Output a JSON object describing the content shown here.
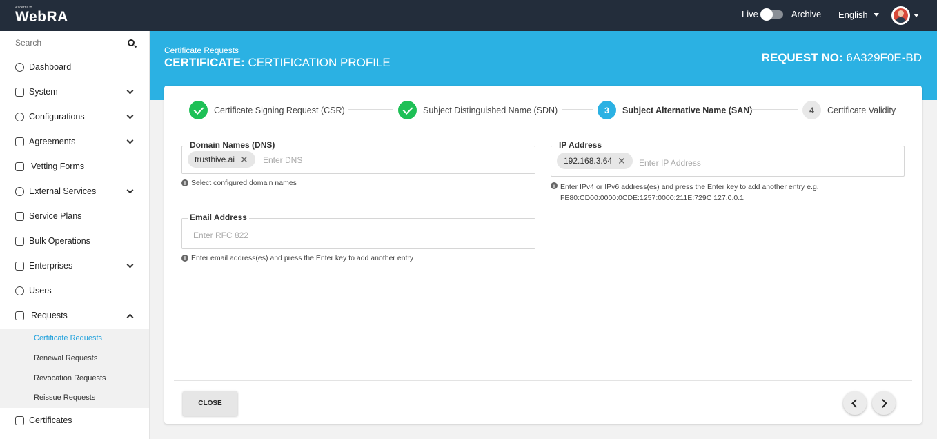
{
  "topbar": {
    "brand_small": "Ascertia™",
    "brand": "WebRA",
    "live_label": "Live",
    "archive_label": "Archive",
    "language": "English"
  },
  "sidebar": {
    "search_placeholder": "Search",
    "items": [
      {
        "label": "Dashboard",
        "icon": "dashboard-icon"
      },
      {
        "label": "System",
        "icon": "system-icon"
      },
      {
        "label": "Configurations",
        "icon": "gear-icon"
      },
      {
        "label": "Agreements",
        "icon": "handshake-icon"
      },
      {
        "label": "Vetting Forms",
        "icon": "form-icon"
      },
      {
        "label": "External Services",
        "icon": "link-icon"
      },
      {
        "label": "Service Plans",
        "icon": "plans-icon"
      },
      {
        "label": "Bulk Operations",
        "icon": "boxes-icon"
      },
      {
        "label": "Enterprises",
        "icon": "bank-icon"
      },
      {
        "label": "Users",
        "icon": "user-icon"
      },
      {
        "label": "Requests",
        "icon": "requests-icon"
      },
      {
        "label": "Certificates",
        "icon": "certificate-icon"
      }
    ],
    "subitems": [
      "Certificate Requests",
      "Renewal Requests",
      "Revocation Requests",
      "Reissue Requests"
    ]
  },
  "header": {
    "breadcrumb": "Certificate Requests",
    "title_bold": "CERTIFICATE:",
    "title_rest": "CERTIFICATION PROFILE",
    "request_label": "REQUEST NO:",
    "request_no": "6A329F0E-BD"
  },
  "steps": [
    {
      "num": "",
      "label": "Certificate Signing Request (CSR)",
      "state": "done"
    },
    {
      "num": "",
      "label": "Subject Distinguished Name (SDN)",
      "state": "done"
    },
    {
      "num": "3",
      "label": "Subject Alternative Name (SAN)",
      "state": "current"
    },
    {
      "num": "4",
      "label": "Certificate Validity",
      "state": "todo"
    }
  ],
  "form": {
    "dns": {
      "legend": "Domain Names (DNS)",
      "chip": "trusthive.ai",
      "placeholder": "Enter DNS",
      "hint": "Select configured domain names"
    },
    "ip": {
      "legend": "IP Address",
      "chip": "192.168.3.64",
      "placeholder": "Enter IP Address",
      "hint1": "Enter IPv4 or IPv6 address(es) and press the Enter key to add another entry e.g.",
      "hint2": "FE80:CD00:0000:0CDE:1257:0000:211E:729C 127.0.0.1"
    },
    "email": {
      "legend": "Email Address",
      "placeholder": "Enter RFC 822",
      "hint": "Enter email address(es) and press the Enter key to add another entry"
    }
  },
  "footer": {
    "close_label": "CLOSE"
  },
  "colors": {
    "topbar": "#232d3b",
    "accent": "#2bb1e3",
    "done": "#1ec056"
  }
}
